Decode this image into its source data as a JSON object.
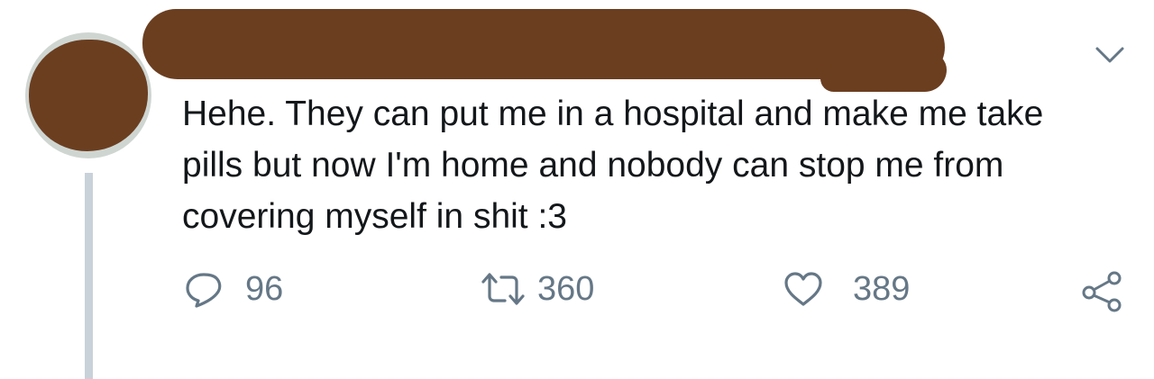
{
  "tweet": {
    "text": "Hehe. They can put me in a hospital and make me take\npills but now I'm home and nobody can stop me from\ncovering myself in shit :3",
    "menu_icon": "chevron-down-icon"
  },
  "actions": {
    "reply": {
      "icon": "reply-icon",
      "count": "96"
    },
    "retweet": {
      "icon": "retweet-icon",
      "count": "360"
    },
    "like": {
      "icon": "heart-icon",
      "count": "389"
    },
    "share": {
      "icon": "share-icon"
    }
  },
  "colors": {
    "text": "#14171a",
    "muted": "#657786",
    "redaction": "#6b3e20",
    "thread_line": "#c9d2d9"
  }
}
